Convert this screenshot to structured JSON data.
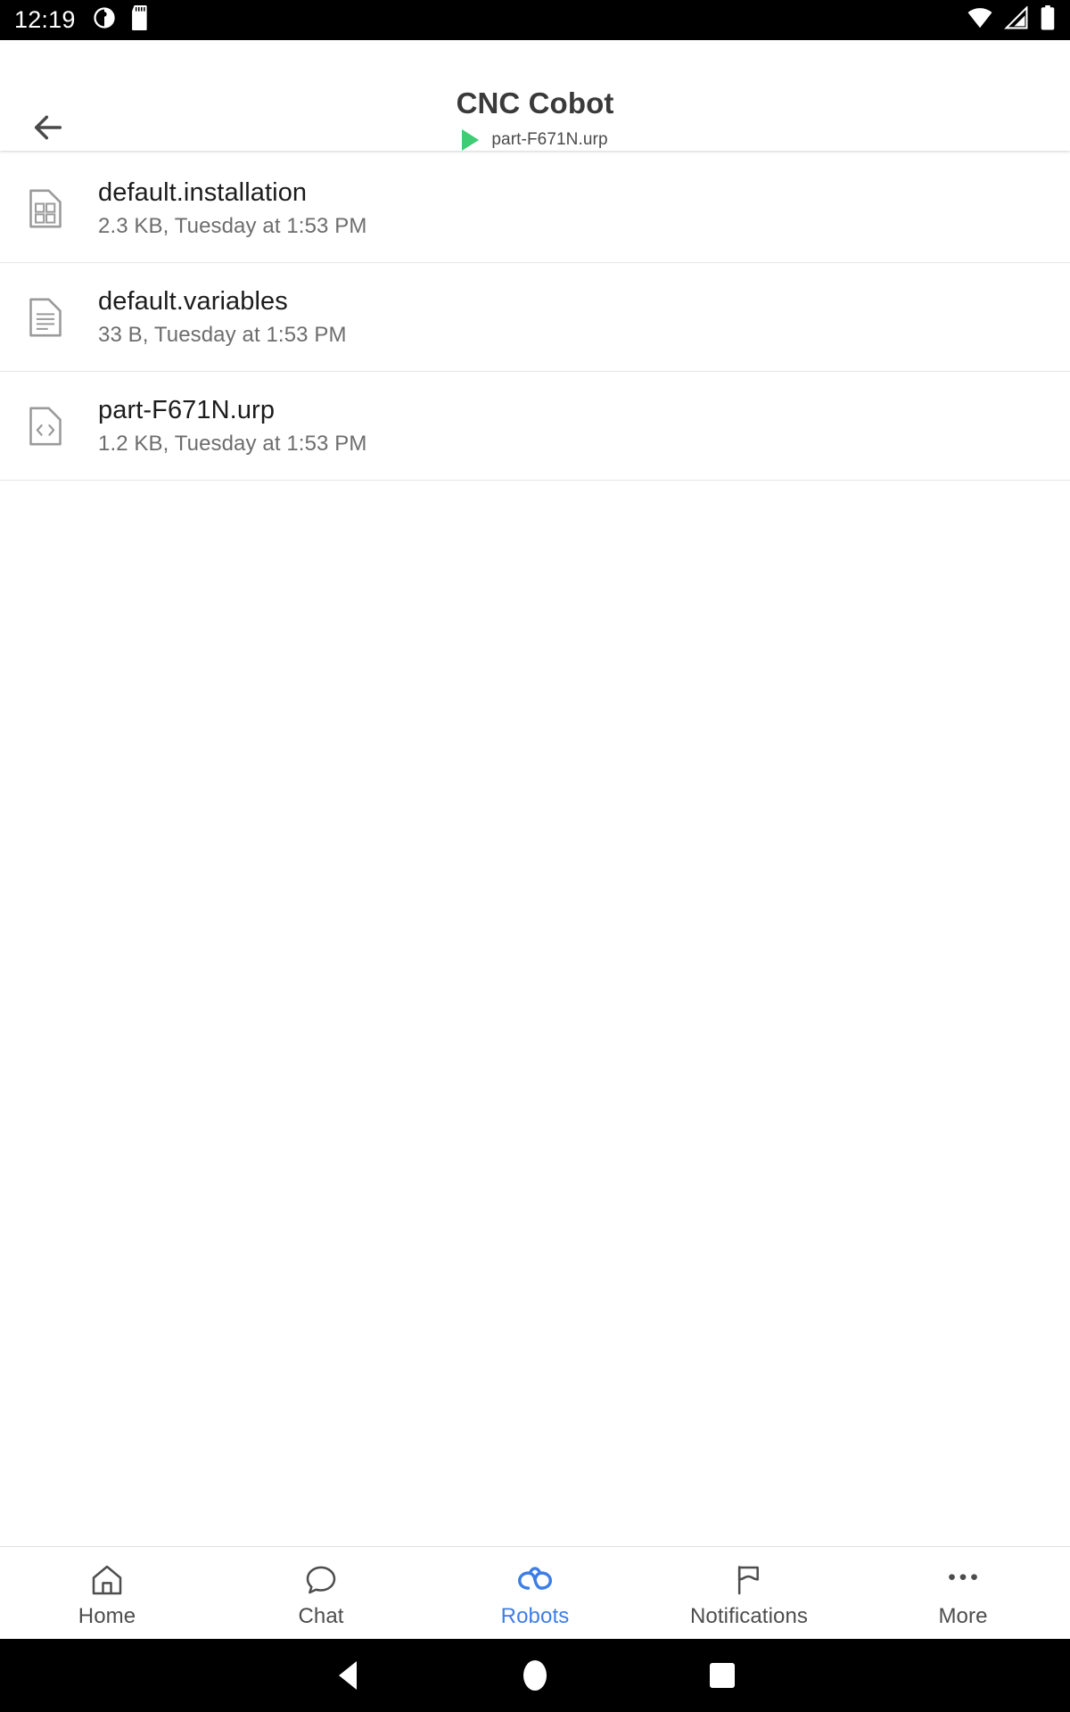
{
  "statusbar": {
    "time": "12:19",
    "left_icons": [
      "timer-icon",
      "sd-card-icon"
    ],
    "right_icons": [
      "wifi-icon",
      "cellular-signal-icon",
      "battery-icon"
    ]
  },
  "header": {
    "back_icon": "back-arrow-icon",
    "title": "CNC Cobot",
    "status_icon": "play-icon",
    "status_color": "#3ecc74",
    "program": "part-F671N.urp"
  },
  "files": [
    {
      "icon": "binary-file-icon",
      "name": "default.installation",
      "meta": "2.3 KB, Tuesday at 1:53 PM"
    },
    {
      "icon": "text-file-icon",
      "name": "default.variables",
      "meta": "33 B, Tuesday at 1:53 PM"
    },
    {
      "icon": "code-file-icon",
      "name": "part-F671N.urp",
      "meta": "1.2 KB, Tuesday at 1:53 PM"
    }
  ],
  "bottom_nav": {
    "active_color": "#3d7ee6",
    "inactive_color": "#4d4d4d",
    "items": [
      {
        "icon": "home-icon",
        "label": "Home",
        "active": false
      },
      {
        "icon": "chat-bubble-icon",
        "label": "Chat",
        "active": false
      },
      {
        "icon": "robots-icon",
        "label": "Robots",
        "active": true
      },
      {
        "icon": "flag-icon",
        "label": "Notifications",
        "active": false
      },
      {
        "icon": "more-dots-icon",
        "label": "More",
        "active": false
      }
    ]
  },
  "system_nav": {
    "back": "system-back-icon",
    "home": "system-home-icon",
    "recents": "system-recents-icon"
  }
}
